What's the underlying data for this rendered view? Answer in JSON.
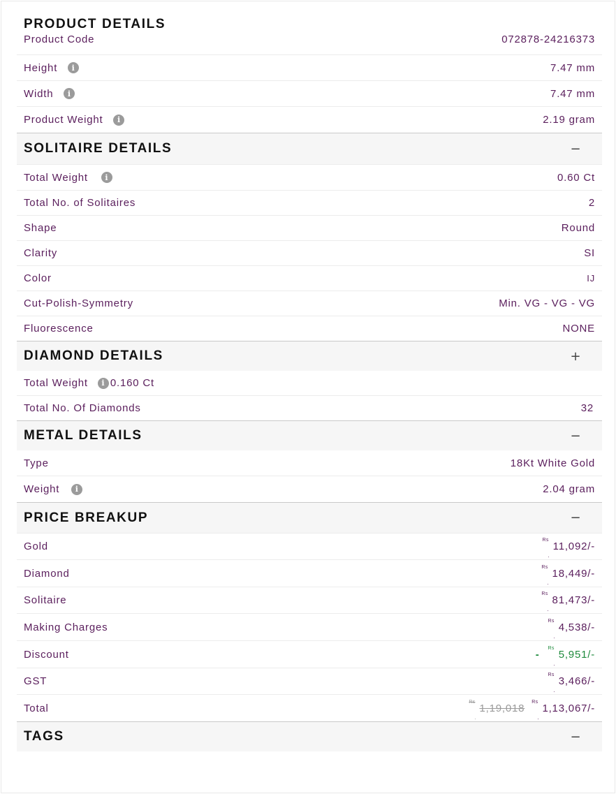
{
  "product_details": {
    "title": "PRODUCT DETAILS",
    "rows": [
      {
        "label": "Product Code",
        "value": "072878-24216373"
      },
      {
        "label": "Height",
        "value": "7.47 mm"
      },
      {
        "label": "Width",
        "value": "7.47 mm"
      },
      {
        "label": "Product Weight",
        "value": "2.19 gram"
      }
    ]
  },
  "solitaire_details": {
    "title": "SOLITAIRE DETAILS",
    "toggle": "−",
    "rows": [
      {
        "label": "Total Weight",
        "value": "0.60 Ct"
      },
      {
        "label": "Total No. of Solitaires",
        "value": "2"
      },
      {
        "label": "Shape",
        "value": "Round"
      },
      {
        "label": "Clarity",
        "value": "SI"
      },
      {
        "label": "Color",
        "value": "IJ"
      },
      {
        "label": "Cut-Polish-Symmetry",
        "value": "Min. VG - VG - VG"
      },
      {
        "label": "Fluorescence",
        "value": "NONE"
      }
    ]
  },
  "diamond_details": {
    "title": "DIAMOND DETAILS",
    "toggle": "+",
    "rows": [
      {
        "label": "Total Weight",
        "value": "0.160 Ct"
      },
      {
        "label": "Total No. Of Diamonds",
        "value": "32"
      }
    ]
  },
  "metal_details": {
    "title": "METAL DETAILS",
    "toggle": "−",
    "rows": [
      {
        "label": "Type",
        "value": "18Kt White Gold"
      },
      {
        "label": "Weight",
        "value": "2.04 gram"
      }
    ]
  },
  "price_breakup": {
    "title": "PRICE BREAKUP",
    "toggle": "−",
    "currency": "Rs",
    "rows": [
      {
        "label": "Gold",
        "value": "11,092/-"
      },
      {
        "label": "Diamond",
        "value": "18,449/-"
      },
      {
        "label": "Solitaire",
        "value": "81,473/-"
      },
      {
        "label": "Making Charges",
        "value": "4,538/-"
      },
      {
        "label": "Discount",
        "prefix": "-",
        "value": "5,951/-"
      },
      {
        "label": "GST",
        "value": "3,466/-"
      },
      {
        "label": "Total",
        "original": "1,19,018",
        "value": "1,13,067/-"
      }
    ]
  },
  "tags": {
    "title": "TAGS",
    "toggle": "−"
  },
  "colors": {
    "text": "#5a1e5c",
    "heading": "#111111",
    "discount": "#1e8a3c",
    "strike": "#9a9a9a",
    "section_bg": "#f6f6f6"
  },
  "icons": {
    "info": "info-icon"
  }
}
